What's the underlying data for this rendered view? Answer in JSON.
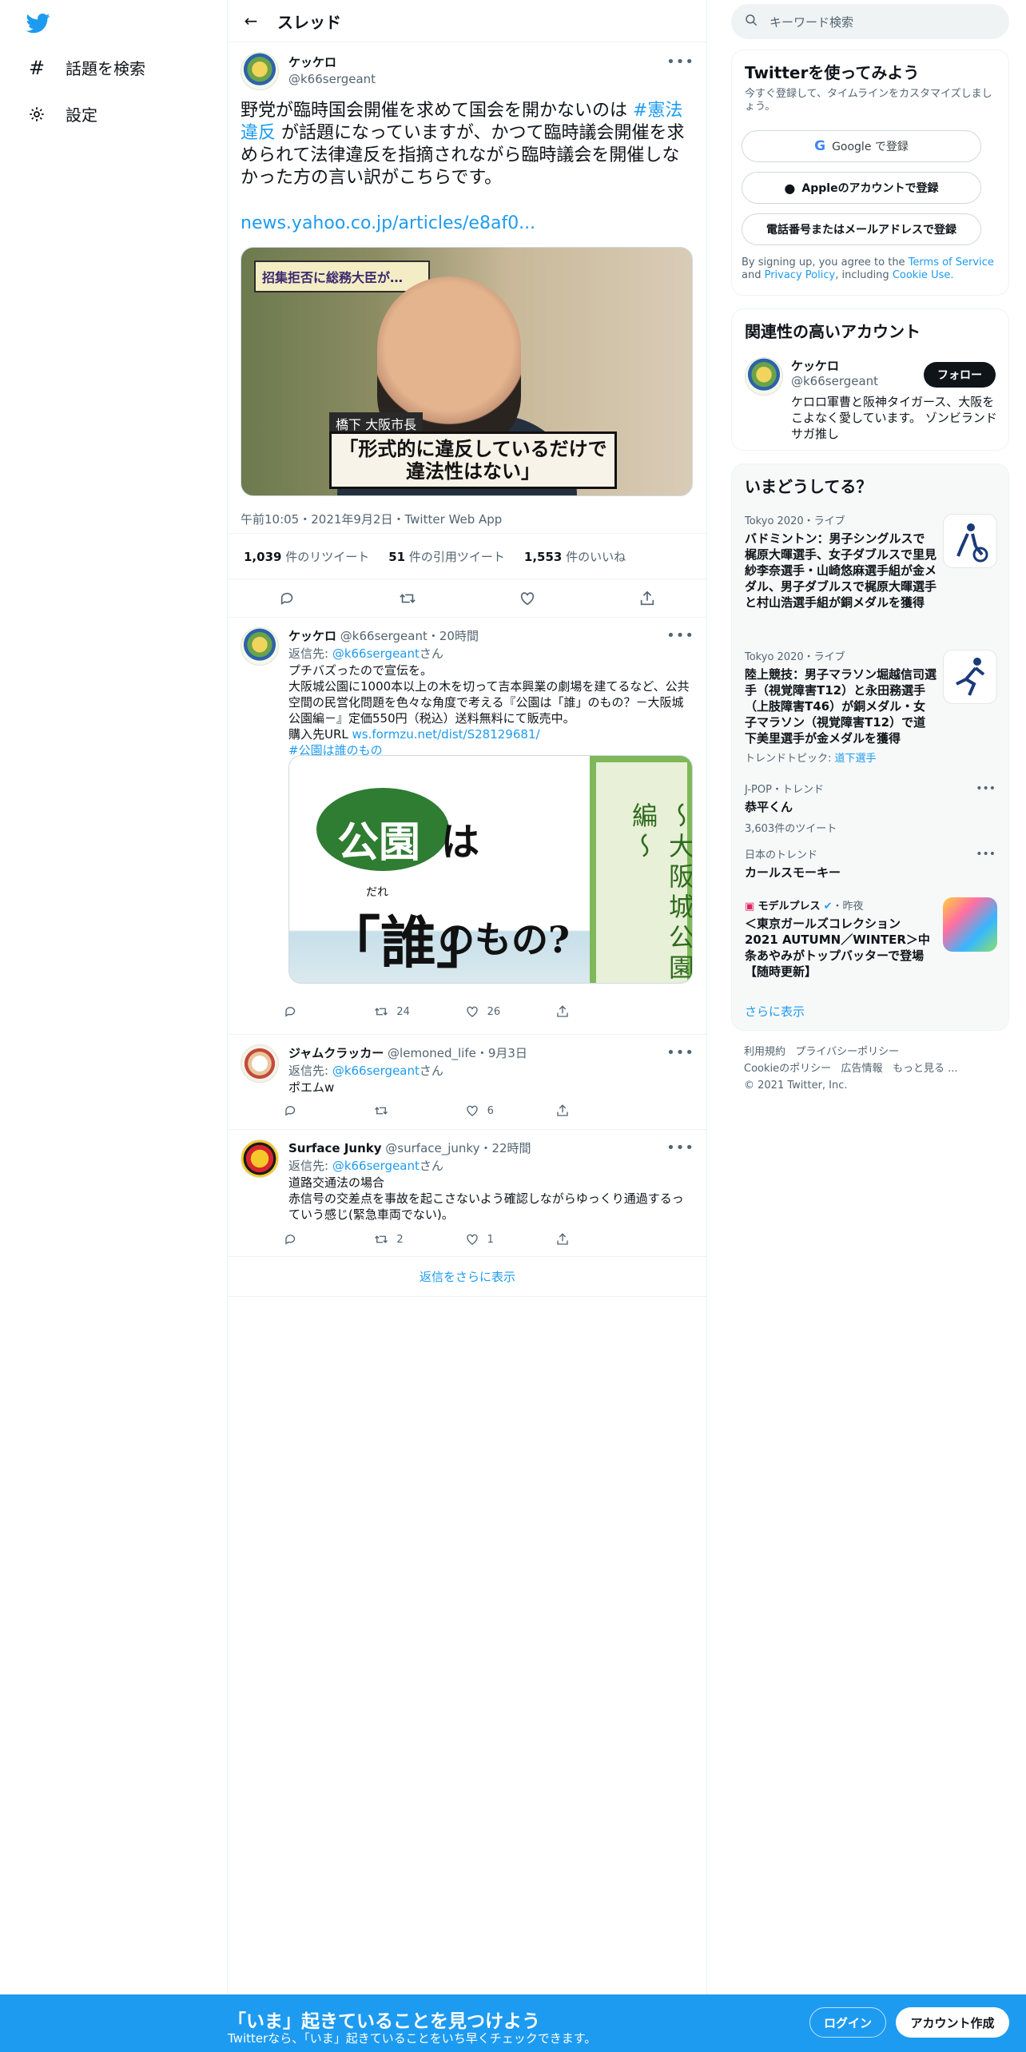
{
  "nav": {
    "items": [
      {
        "label": "話題を検索",
        "icon": "hashtag-icon"
      },
      {
        "label": "設定",
        "icon": "gear-icon"
      }
    ]
  },
  "header": {
    "title": "スレッド"
  },
  "focus_tweet": {
    "name": "ケッケロ",
    "handle": "@k66sergeant",
    "text_before": "野党が臨時国会開催を求めて国会を開かないのは ",
    "hashtag": "#憲法違反",
    "text_after": " が話題になっていますが、かつて臨時議会開催を求められて法律違反を指摘されながら臨時議会を開催しなかった方の言い訳がこちらです。",
    "link": "news.yahoo.co.jp/articles/e8af0...",
    "media_caption": "「形式的に違反しているだけで違法性はない」",
    "media_name_tag": "橋下 大阪市長",
    "media_top_text": "招集拒否に総務大臣が…",
    "timestamp": "午前10:05・2021年9月2日・Twitter Web App",
    "retweets": "1,039",
    "retweets_label": "件のリツイート",
    "quotes": "51",
    "quotes_label": "件の引用ツイート",
    "likes": "1,553",
    "likes_label": "件のいいね"
  },
  "replies": [
    {
      "name": "ケッケロ",
      "handle": "@k66sergeant",
      "time": "・20時間",
      "reply_to_prefix": "返信先: ",
      "reply_to": "@k66sergeant",
      "reply_to_suffix": "さん",
      "lines": [
        "プチバズったので宣伝を。",
        "大阪城公園に1000本以上の木を切って吉本興業の劇場を建てるなど、公共空間の民営化問題を色々な角度で考える『公園は「誰」のもの？－大阪城公園編－』定価550円（税込）送料無料にて販売中。"
      ],
      "url_prefix": "購入先URL ",
      "url": "ws.formzu.net/dist/S28129681/",
      "tag": "#公園は誰のもの",
      "media": {
        "kouen": "公園",
        "ha": "は",
        "dare": "「誰」",
        "ruby": "だれ",
        "nomono": "のもの?",
        "vertical": "〜大阪城公園編〜"
      },
      "retweets": "24",
      "likes": "26"
    },
    {
      "name": "ジャムクラッカー",
      "handle": "@lemoned_life",
      "time": "・9月3日",
      "reply_to_prefix": "返信先: ",
      "reply_to": "@k66sergeant",
      "reply_to_suffix": "さん",
      "text": "ポエムw",
      "retweets": "",
      "likes": "6"
    },
    {
      "name": "Surface Junky",
      "handle": "@surface_junky",
      "time": "・22時間",
      "reply_to_prefix": "返信先: ",
      "reply_to": "@k66sergeant",
      "reply_to_suffix": "さん",
      "text": "道路交通法の場合\n赤信号の交差点を事故を起こさないよう確認しながらゆっくり通過するっていう感じ(緊急車両でない)。",
      "retweets": "2",
      "likes": "1"
    }
  ],
  "more_replies": "返信をさらに表示",
  "right": {
    "search_placeholder": "キーワード検索",
    "signup": {
      "title": "Twitterを使ってみよう",
      "subtitle": "今すぐ登録して、タイムラインをカスタマイズしましょう。",
      "google": "Google で登録",
      "apple": "Appleのアカウントで登録",
      "phone": "電話番号またはメールアドレスで登録",
      "terms_a": "By signing up, you agree to the ",
      "terms_tos": "Terms of Service",
      "terms_and": " and ",
      "terms_privacy": "Privacy Policy",
      "terms_inc": ", including ",
      "terms_cookie": "Cookie Use."
    },
    "related": {
      "title": "関連性の高いアカウント",
      "name": "ケッケロ",
      "handle": "@k66sergeant",
      "bio": "ケロロ軍曹と阪神タイガース、大阪をこよなく愛しています。 ゾンビランドサガ推し",
      "follow": "フォロー"
    },
    "trends": {
      "title": "いまどうしてる？",
      "items": [
        {
          "category": "Tokyo 2020・ライブ",
          "title": "バドミントン：男子シングルスで梶原大暉選手、女子ダブルスで里見紗李奈選手・山崎悠麻選手組が金メダル、男子ダブルスで梶原大暉選手と村山浩選手組が銅メダルを獲得"
        },
        {
          "category": "Tokyo 2020・ライブ",
          "title": "陸上競技：男子マラソン堀越信司選手（視覚障害T12）と永田務選手（上肢障害T46）が銅メダル・女子マラソン（視覚障害T12）で道下美里選手が金メダルを獲得",
          "topic_prefix": "トレンドトピック: ",
          "topic": "道下選手"
        },
        {
          "category": "J-POP・トレンド",
          "title": "恭平くん",
          "count": "3,603件のツイート"
        },
        {
          "category": "日本のトレンド",
          "title": "カールスモーキー"
        },
        {
          "category_name": "モデルプレス",
          "category_time": "・昨夜",
          "title": "＜東京ガールズコレクション 2021 AUTUMN／WINTER＞中条あやみがトップバッターで登場【随時更新】"
        }
      ],
      "more": "さらに表示"
    },
    "footer": [
      "利用規約",
      "プライバシーポリシー",
      "Cookieのポリシー",
      "広告情報",
      "もっと見る ...",
      "© 2021 Twitter, Inc."
    ]
  },
  "banner": {
    "title": "「いま」起きていることを見つけよう",
    "subtitle": "Twitterなら、「いま」起きていることをいち早くチェックできます。",
    "login": "ログイン",
    "signup": "アカウント作成"
  },
  "colors": {
    "accent": "#1d9bf0",
    "text": "#0f1419",
    "muted": "#536471"
  }
}
